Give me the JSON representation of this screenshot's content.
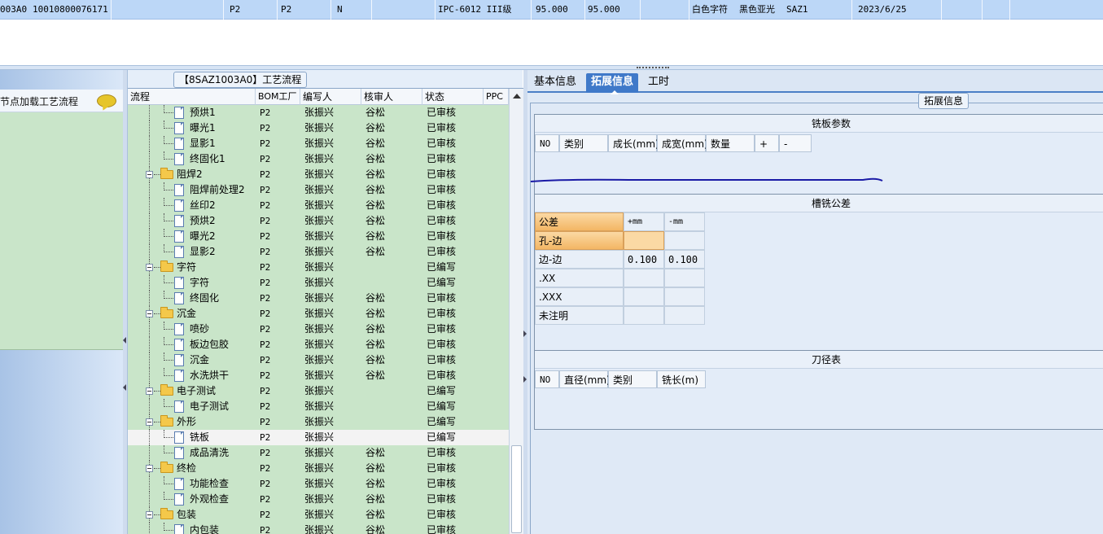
{
  "top_row": {
    "cells": [
      "003A0",
      "10010800076171",
      "P2",
      "P2",
      "N",
      "IPC-6012 III级",
      "95.000",
      "95.000",
      "白色字符",
      "黑色亚光",
      "SAZ1",
      "2023/6/25"
    ]
  },
  "left_panel": {
    "header_text": "节点加载工艺流程"
  },
  "process_tree": {
    "title": "【8SAZ1003A0】工艺流程",
    "columns": [
      "流程",
      "BOM工厂",
      "编写人",
      "核审人",
      "状态",
      "PPC"
    ],
    "rows": [
      {
        "name": "预烘1",
        "factory": "P2",
        "writer": "张振兴",
        "reviewer": "谷松",
        "status": "已审核",
        "level": 2
      },
      {
        "name": "曝光1",
        "factory": "P2",
        "writer": "张振兴",
        "reviewer": "谷松",
        "status": "已审核",
        "level": 2
      },
      {
        "name": "显影1",
        "factory": "P2",
        "writer": "张振兴",
        "reviewer": "谷松",
        "status": "已审核",
        "level": 2
      },
      {
        "name": "终固化1",
        "factory": "P2",
        "writer": "张振兴",
        "reviewer": "谷松",
        "status": "已审核",
        "level": 2
      },
      {
        "name": "阻焊2",
        "factory": "P2",
        "writer": "张振兴",
        "reviewer": "谷松",
        "status": "已审核",
        "level": 1
      },
      {
        "name": "阻焊前处理2",
        "factory": "P2",
        "writer": "张振兴",
        "reviewer": "谷松",
        "status": "已审核",
        "level": 2
      },
      {
        "name": "丝印2",
        "factory": "P2",
        "writer": "张振兴",
        "reviewer": "谷松",
        "status": "已审核",
        "level": 2
      },
      {
        "name": "预烘2",
        "factory": "P2",
        "writer": "张振兴",
        "reviewer": "谷松",
        "status": "已审核",
        "level": 2
      },
      {
        "name": "曝光2",
        "factory": "P2",
        "writer": "张振兴",
        "reviewer": "谷松",
        "status": "已审核",
        "level": 2
      },
      {
        "name": "显影2",
        "factory": "P2",
        "writer": "张振兴",
        "reviewer": "谷松",
        "status": "已审核",
        "level": 2
      },
      {
        "name": "字符",
        "factory": "P2",
        "writer": "张振兴",
        "reviewer": "",
        "status": "已编写",
        "level": 1
      },
      {
        "name": "字符",
        "factory": "P2",
        "writer": "张振兴",
        "reviewer": "",
        "status": "已编写",
        "level": 2
      },
      {
        "name": "终固化",
        "factory": "P2",
        "writer": "张振兴",
        "reviewer": "谷松",
        "status": "已审核",
        "level": 2
      },
      {
        "name": "沉金",
        "factory": "P2",
        "writer": "张振兴",
        "reviewer": "谷松",
        "status": "已审核",
        "level": 1
      },
      {
        "name": "喷砂",
        "factory": "P2",
        "writer": "张振兴",
        "reviewer": "谷松",
        "status": "已审核",
        "level": 2
      },
      {
        "name": "板边包胶",
        "factory": "P2",
        "writer": "张振兴",
        "reviewer": "谷松",
        "status": "已审核",
        "level": 2
      },
      {
        "name": "沉金",
        "factory": "P2",
        "writer": "张振兴",
        "reviewer": "谷松",
        "status": "已审核",
        "level": 2
      },
      {
        "name": "水洗烘干",
        "factory": "P2",
        "writer": "张振兴",
        "reviewer": "谷松",
        "status": "已审核",
        "level": 2
      },
      {
        "name": "电子测试",
        "factory": "P2",
        "writer": "张振兴",
        "reviewer": "",
        "status": "已编写",
        "level": 1
      },
      {
        "name": "电子测试",
        "factory": "P2",
        "writer": "张振兴",
        "reviewer": "",
        "status": "已编写",
        "level": 2
      },
      {
        "name": "外形",
        "factory": "P2",
        "writer": "张振兴",
        "reviewer": "",
        "status": "已编写",
        "level": 1
      },
      {
        "name": "铣板",
        "factory": "P2",
        "writer": "张振兴",
        "reviewer": "",
        "status": "已编写",
        "level": 2,
        "selected": true
      },
      {
        "name": "成品清洗",
        "factory": "P2",
        "writer": "张振兴",
        "reviewer": "谷松",
        "status": "已审核",
        "level": 2
      },
      {
        "name": "终检",
        "factory": "P2",
        "writer": "张振兴",
        "reviewer": "谷松",
        "status": "已审核",
        "level": 1
      },
      {
        "name": "功能检查",
        "factory": "P2",
        "writer": "张振兴",
        "reviewer": "谷松",
        "status": "已审核",
        "level": 2
      },
      {
        "name": "外观检查",
        "factory": "P2",
        "writer": "张振兴",
        "reviewer": "谷松",
        "status": "已审核",
        "level": 2
      },
      {
        "name": "包装",
        "factory": "P2",
        "writer": "张振兴",
        "reviewer": "谷松",
        "status": "已审核",
        "level": 1
      },
      {
        "name": "内包装",
        "factory": "P2",
        "writer": "张振兴",
        "reviewer": "谷松",
        "status": "已审核",
        "level": 2
      }
    ]
  },
  "right_panel": {
    "tabs": [
      {
        "label": "基本信息",
        "active": false
      },
      {
        "label": "拓展信息",
        "active": true
      },
      {
        "label": "工时",
        "active": false
      }
    ],
    "group_title": "拓展信息",
    "milling_params": {
      "title": "铣板参数",
      "columns": [
        "NO",
        "类别",
        "成长(mm)",
        "成宽(mm)",
        "数量",
        "+",
        "-"
      ]
    },
    "slot_tolerance": {
      "title": "槽铣公差",
      "columns": [
        "公差",
        "+mm",
        "-mm"
      ],
      "rows": [
        {
          "label": "孔-边",
          "plus": "",
          "minus": ""
        },
        {
          "label": "边-边",
          "plus": "0.100",
          "minus": "0.100"
        },
        {
          "label": ".XX",
          "plus": "",
          "minus": ""
        },
        {
          "label": ".XXX",
          "plus": "",
          "minus": ""
        },
        {
          "label": "未注明",
          "plus": "",
          "minus": ""
        }
      ]
    },
    "tool_table": {
      "title": "刀径表",
      "columns": [
        "NO",
        "直径(mm)",
        "类别",
        "铣长(m)"
      ]
    }
  },
  "colors": {
    "row_green": "#c9e5c9",
    "tab_active": "#3f79c9",
    "selected_row_top": "#bcd7f7",
    "tolerance_highlight": "#f3b664",
    "pen_stroke": "#1a1aa6"
  }
}
